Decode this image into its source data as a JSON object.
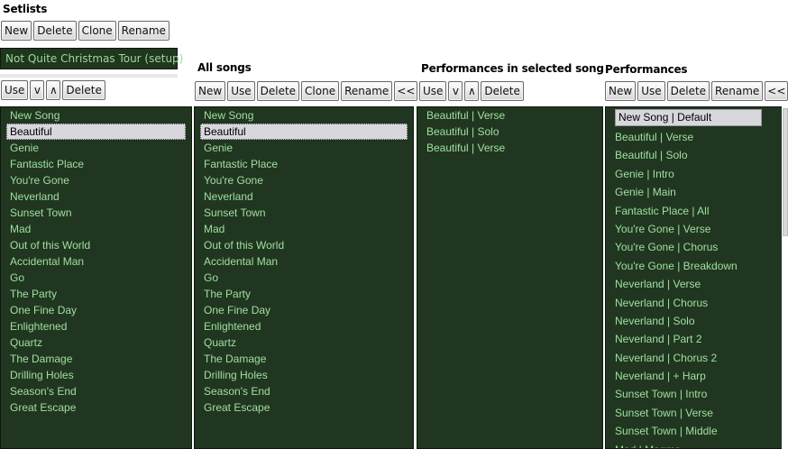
{
  "setlists": {
    "title": "Setlists",
    "buttons": {
      "new": "New",
      "delete": "Delete",
      "clone": "Clone",
      "rename": "Rename"
    },
    "selected": "Not Quite Christmas Tour (setup)"
  },
  "setlist_songs": {
    "buttons": {
      "use": "Use",
      "down": "v",
      "up": "∧",
      "delete": "Delete"
    },
    "items": [
      "New Song",
      "Beautiful",
      "Genie",
      "Fantastic Place",
      "You're Gone",
      "Neverland",
      "Sunset Town",
      "Mad",
      "Out of this World",
      "Accidental Man",
      "Go",
      "The Party",
      "One Fine Day",
      "Enlightened",
      "Quartz",
      "The Damage",
      "Drilling Holes",
      "Season's End",
      "Great Escape"
    ],
    "selected_index": 1
  },
  "all_songs": {
    "title": "All songs",
    "buttons": {
      "new": "New",
      "use": "Use",
      "delete": "Delete",
      "clone": "Clone",
      "rename": "Rename",
      "back": "<<"
    },
    "items": [
      "New Song",
      "Beautiful",
      "Genie",
      "Fantastic Place",
      "You're Gone",
      "Neverland",
      "Sunset Town",
      "Mad",
      "Out of this World",
      "Accidental Man",
      "Go",
      "The Party",
      "One Fine Day",
      "Enlightened",
      "Quartz",
      "The Damage",
      "Drilling Holes",
      "Season's End",
      "Great Escape"
    ],
    "selected_index": 1
  },
  "song_performances": {
    "title": "Performances in selected song",
    "buttons": {
      "use": "Use",
      "down": "v",
      "up": "∧",
      "delete": "Delete"
    },
    "items": [
      "Beautiful | Verse",
      "Beautiful | Solo",
      "Beautiful | Verse"
    ]
  },
  "performances": {
    "title": "Performances",
    "buttons": {
      "new": "New",
      "use": "Use",
      "delete": "Delete",
      "rename": "Rename",
      "back": "<<"
    },
    "items": [
      "New Song | Default",
      "Beautiful | Verse",
      "Beautiful | Solo",
      "Genie | Intro",
      "Genie | Main",
      "Fantastic Place | All",
      "You're Gone | Verse",
      "You're Gone | Chorus",
      "You're Gone | Breakdown",
      "Neverland | Verse",
      "Neverland | Chorus",
      "Neverland | Solo",
      "Neverland | Part 2",
      "Neverland | Chorus 2",
      "Neverland | + Harp",
      "Sunset Town | Intro",
      "Sunset Town | Verse",
      "Sunset Town | Middle",
      "Mad | Magma"
    ],
    "selected_index": 0
  }
}
